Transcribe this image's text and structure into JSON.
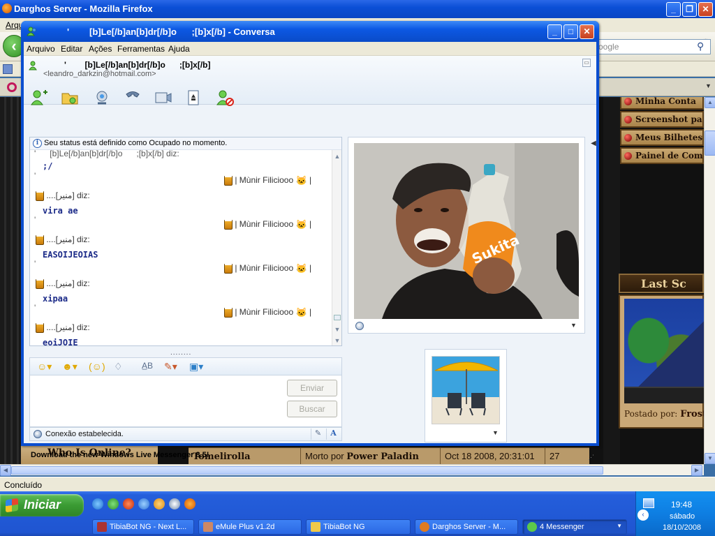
{
  "firefox": {
    "title": "Darghos Server - Mozilla Firefox",
    "menu_first": "Arqu",
    "search_placeholder": "oogle",
    "status": "Concluído"
  },
  "website": {
    "side_menu": [
      "Minha Conta",
      "Screenshot par",
      "Meus Bilhetes",
      "Painel de Coma"
    ],
    "last_screens_heading": "Last Sc",
    "posted_by_label": "Postado por:",
    "posted_by_name": "Frost F",
    "who_online": "Who Is Online?",
    "kill": {
      "name": "Tomelirolla",
      "killed_by_label": "Morto por",
      "killer": "Power Paladin",
      "date": "Oct 18 2008, 20:31:01",
      "level": "27"
    }
  },
  "messenger": {
    "title": "'        [b]Le[/b]an[b]dr[/b]o      ;[b]x[/b] - Conversa",
    "menu": [
      "Arquivo",
      "Editar",
      "Ações",
      "Ferramentas",
      "Ajuda"
    ],
    "contact_name": "'        [b]Le[/b]an[b]dr[/b]o      ;[b]x[/b]",
    "contact_email": "<leandro_darkzin@hotmail.com>",
    "status_note": "Seu status está definido como Ocupado no momento.",
    "messages": {
      "first_header": "[b]Le[/b]an[b]dr[/b]o      ;[b]x[/b] diz:",
      "first_text": ";/",
      "nick": "| Mùnir Filiciooo",
      "nick_tail": "|",
      "my_header": "....[منير] diz:",
      "texts": [
        "vira ae",
        "EASOIJEOIAS",
        "xipaa",
        "eoiJOIE"
      ]
    },
    "send_button": "Enviar",
    "search_button": "Buscar",
    "connection": "Conexão estabelecida.",
    "promo": "Download the new Windows Live Messenger 8.5!"
  },
  "taskbar": {
    "start": "Iniciar",
    "tasks": [
      "TibiaBot NG - Next L...",
      "eMule Plus v1.2d",
      "TibiaBot NG",
      "Darghos Server - M...",
      "4 Messenger"
    ],
    "time": "19:48",
    "day": "sábado",
    "date": "18/10/2008"
  },
  "colors": {
    "xp_blue": "#0a4ed0",
    "start_green": "#3a9b33",
    "chat_text_blue": "#1b2a88",
    "site_gold": "#b99a6a"
  }
}
